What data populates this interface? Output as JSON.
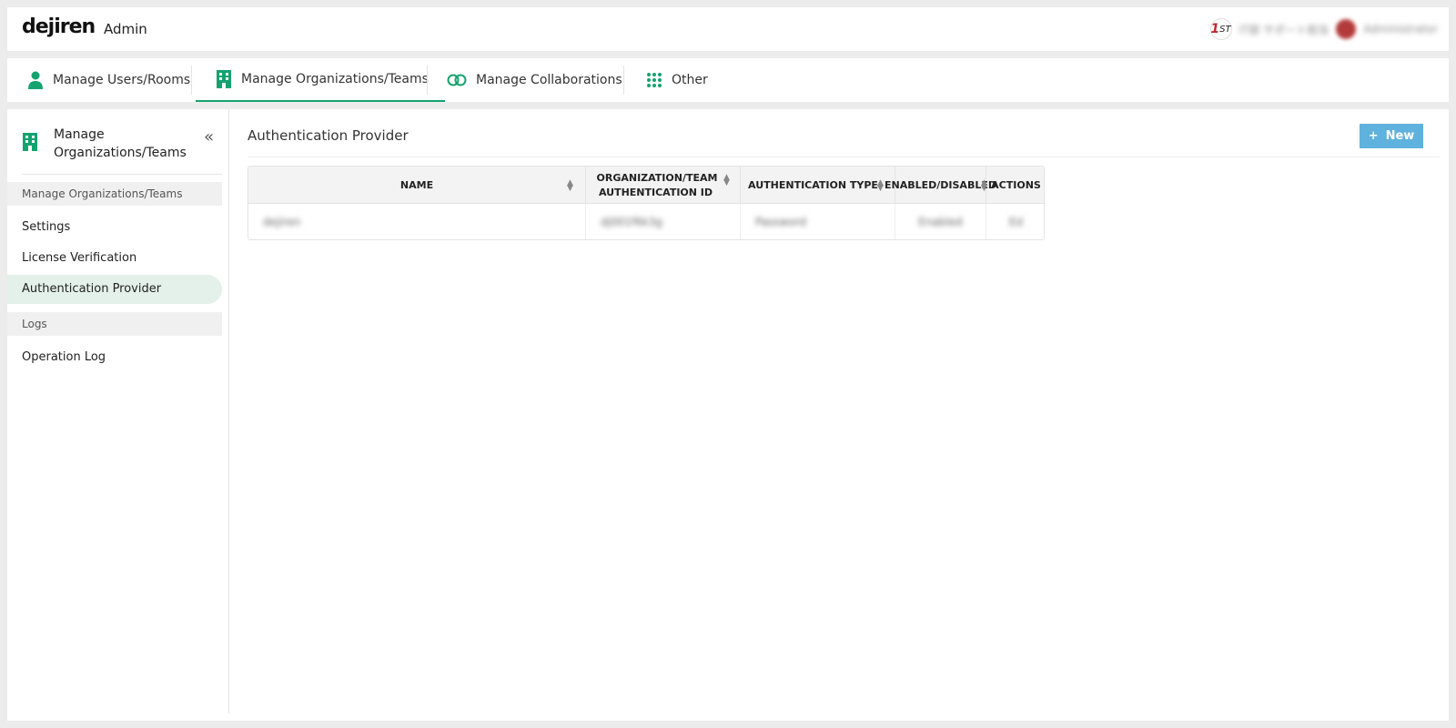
{
  "header": {
    "logo": "dejiren",
    "section": "Admin",
    "badge": {
      "mark": "1",
      "suffix": "ST"
    },
    "user_info": "IT部 サポート担当",
    "user_name": "Administrator"
  },
  "nav": {
    "tabs": [
      {
        "label": "Manage Users/Rooms",
        "icon": "user-icon"
      },
      {
        "label": "Manage Organizations/Teams",
        "icon": "building-icon",
        "active": true
      },
      {
        "label": "Manage Collaborations",
        "icon": "link-icon"
      },
      {
        "label": "Other",
        "icon": "grid-icon"
      }
    ]
  },
  "sidebar": {
    "title": "Manage Organizations/Teams",
    "collapse_glyph": "«",
    "sections": [
      {
        "label": "Manage Organizations/Teams"
      },
      {
        "label": "Logs"
      }
    ],
    "items": [
      {
        "label": "Settings"
      },
      {
        "label": "License Verification"
      },
      {
        "label": "Authentication Provider",
        "active": true
      },
      {
        "label": "Operation Log"
      }
    ]
  },
  "main": {
    "title": "Authentication Provider",
    "new_button": {
      "plus": "+",
      "label": "New"
    },
    "table": {
      "columns": [
        {
          "label": "NAME"
        },
        {
          "label": "ORGANIZATION/TEAM AUTHENTICATION ID"
        },
        {
          "label": "AUTHENTICATION TYPE"
        },
        {
          "label": "ENABLED/DISABLED"
        },
        {
          "label": "ACTIONS"
        }
      ],
      "rows": [
        {
          "name": "dejiren",
          "auth_id": "dj001f6k3g",
          "type": "Password",
          "status": "Enabled",
          "actions": "Ed"
        }
      ]
    }
  },
  "colors": {
    "accent": "#14a36f",
    "button": "#5fb2dd",
    "active_bg": "#e3f1ea"
  }
}
